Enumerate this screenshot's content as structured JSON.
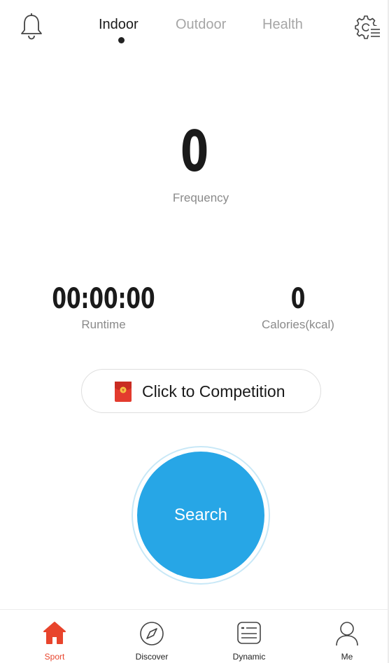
{
  "header": {
    "tabs": [
      {
        "label": "Indoor",
        "active": true
      },
      {
        "label": "Outdoor",
        "active": false
      },
      {
        "label": "Health",
        "active": false
      }
    ],
    "left_icon": "bell-icon",
    "right_icon": "gear-list-icon"
  },
  "metrics": {
    "frequency_value": "0",
    "frequency_label": "Frequency",
    "runtime_value": "00:00:00",
    "runtime_label": "Runtime",
    "calories_value": "0",
    "calories_label": "Calories(kcal)"
  },
  "competition": {
    "label": "Click to Competition",
    "icon": "red-envelope-icon"
  },
  "search": {
    "label": "Search"
  },
  "bottom_nav": {
    "items": [
      {
        "label": "Sport",
        "icon": "home-icon",
        "active": true
      },
      {
        "label": "Discover",
        "icon": "compass-icon",
        "active": false
      },
      {
        "label": "Dynamic",
        "icon": "feed-icon",
        "active": false
      },
      {
        "label": "Me",
        "icon": "user-icon",
        "active": false
      }
    ]
  },
  "colors": {
    "accent_blue": "#27a6e6",
    "active_red": "#e8442c",
    "muted_text": "#8a8a8a"
  }
}
